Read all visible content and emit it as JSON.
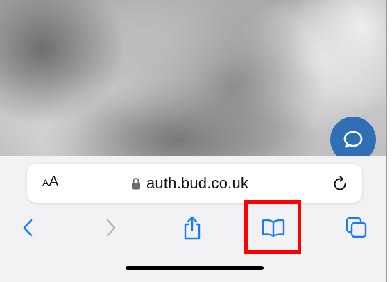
{
  "address_bar": {
    "reader_small": "A",
    "reader_big": "A",
    "url": "auth.bud.co.uk"
  },
  "colors": {
    "accent": "#1a7cf5",
    "disabled": "#b5b5ba",
    "chat_bubble": "#2f6fb6",
    "highlight": "#ff0000"
  },
  "icons": {
    "lock": "lock-icon",
    "reload": "reload-icon",
    "back": "chevron-left-icon",
    "forward": "chevron-right-icon",
    "share": "share-icon",
    "bookmarks": "book-icon",
    "tabs": "tabs-icon",
    "chat": "chat-bubble-icon"
  }
}
